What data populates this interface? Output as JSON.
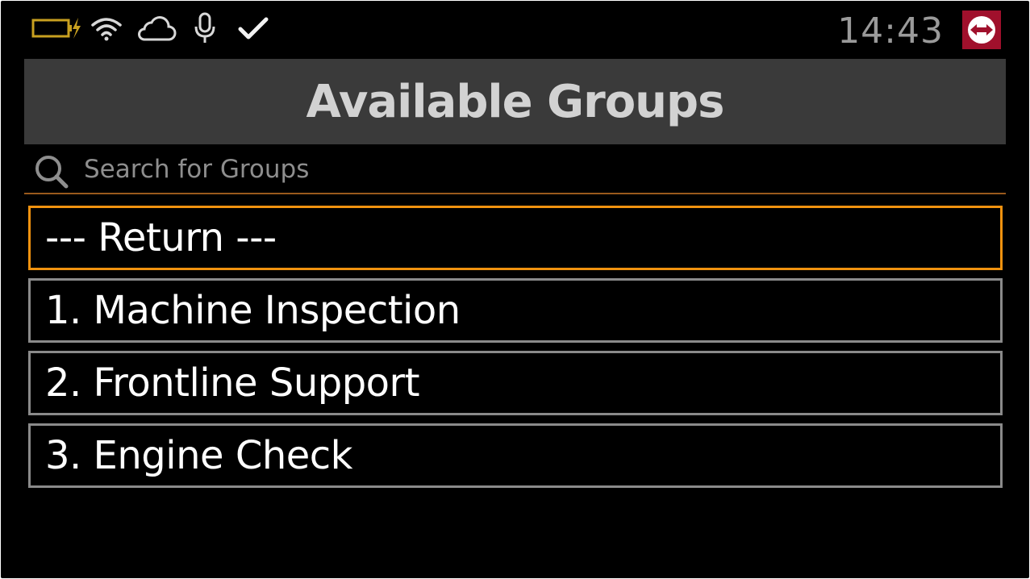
{
  "status_bar": {
    "time": "14:43",
    "icons": [
      "battery-charging-icon",
      "wifi-icon",
      "cloud-icon",
      "microphone-icon",
      "check-icon",
      "teamviewer-icon"
    ],
    "colors": {
      "battery": "#c8a020",
      "icons": "#d8d8d8",
      "clock": "#9a9a9a",
      "teamviewer_bg": "#a0102c"
    }
  },
  "header": {
    "title": "Available Groups",
    "background": "#3a3a3a"
  },
  "search": {
    "placeholder": "Search for Groups",
    "value": "",
    "underline_color": "#9a5a1c"
  },
  "groups": {
    "items": [
      {
        "label": "--- Return ---",
        "selected": true
      },
      {
        "label": "1. Machine Inspection",
        "selected": false
      },
      {
        "label": "2. Frontline Support",
        "selected": false
      },
      {
        "label": "3. Engine Check",
        "selected": false
      }
    ],
    "selected_border_color": "#f0920f",
    "border_color": "#8a8a8a"
  }
}
